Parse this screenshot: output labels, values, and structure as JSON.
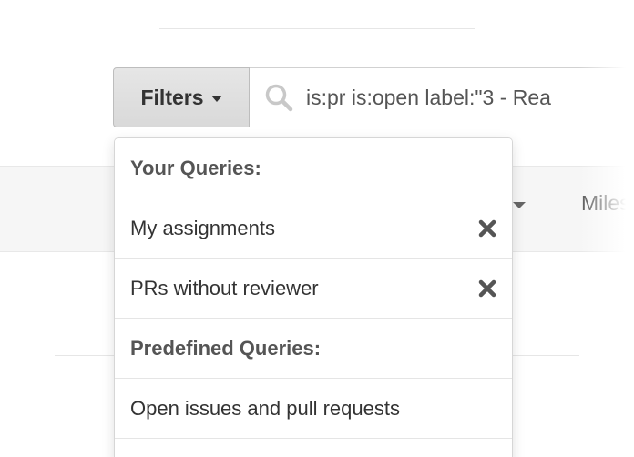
{
  "search": {
    "filters_label": "Filters",
    "query": "is:pr is:open label:\"3 - Rea"
  },
  "background": {
    "milestones_label": "Miles"
  },
  "dropdown": {
    "your_queries_header": "Your Queries:",
    "your_queries": [
      {
        "label": "My assignments",
        "icon": "remove-icon"
      },
      {
        "label": "PRs without reviewer",
        "icon": "remove-icon"
      }
    ],
    "predefined_header": "Predefined Queries:",
    "predefined_queries": [
      {
        "label": "Open issues and pull requests"
      }
    ]
  }
}
